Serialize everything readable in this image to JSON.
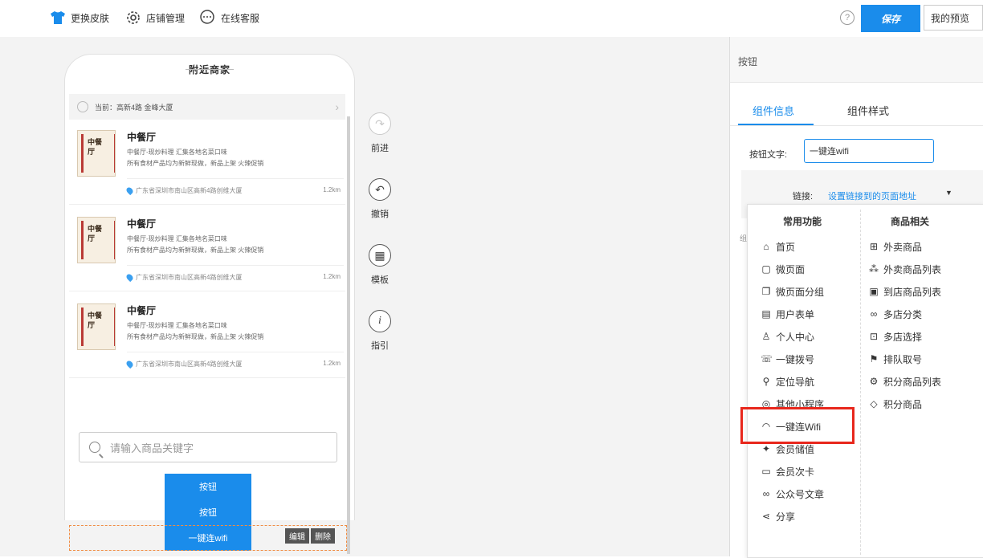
{
  "topbar": {
    "skin_label": "更换皮肤",
    "store_label": "店铺管理",
    "service_label": "在线客服",
    "help_icon": "?",
    "save_label": "保存",
    "preview_label": "我的预览"
  },
  "phone": {
    "title": "附近商家",
    "location_label": "当前：高新4路 金峰大厦",
    "stores": [
      {
        "name": "中餐厅",
        "desc1": "中餐厅-现炒料理   汇集各地名菜口味",
        "desc2": "所有食材产品均为新鲜现做，新品上架 火辣促销",
        "address": "广东省深圳市南山区高新4路创维大厦",
        "distance": "1.2km"
      },
      {
        "name": "中餐厅",
        "desc1": "中餐厅-现炒料理   汇集各地名菜口味",
        "desc2": "所有食材产品均为新鲜现做，新品上架 火辣促销",
        "address": "广东省深圳市南山区高新4路创维大厦",
        "distance": "1.2km"
      },
      {
        "name": "中餐厅",
        "desc1": "中餐厅-现炒料理   汇集各地名菜口味",
        "desc2": "所有食材产品均为新鲜现做，新品上架 火辣促销",
        "address": "广东省深圳市南山区高新4路创维大厦",
        "distance": "1.2km"
      }
    ],
    "logo_glyph": "中餐厅",
    "search_placeholder": "请输入商品关键字",
    "buttons": [
      "按钮",
      "按钮",
      "一键连wifi"
    ],
    "edit_label": "编辑",
    "delete_label": "删除"
  },
  "toolbar": {
    "forward": "前进",
    "undo": "撤销",
    "template": "模板",
    "guide": "指引"
  },
  "panel": {
    "header": "按钮",
    "tab_info": "组件信息",
    "tab_style": "组件样式",
    "button_text_label": "按钮文字:",
    "button_text_value": "一键连wifi",
    "link_label": "链接:",
    "link_value": "设置链接到的页面地址",
    "side_text": "组"
  },
  "dropdown": {
    "col1_header": "常用功能",
    "col2_header": "商品相关",
    "col1": [
      {
        "label": "首页",
        "icon": "home-icon",
        "glyph": "⌂"
      },
      {
        "label": "微页面",
        "icon": "page-icon",
        "glyph": "▢"
      },
      {
        "label": "微页面分组",
        "icon": "pages-icon",
        "glyph": "❐"
      },
      {
        "label": "用户表单",
        "icon": "form-icon",
        "glyph": "▤"
      },
      {
        "label": "个人中心",
        "icon": "user-icon",
        "glyph": "♙"
      },
      {
        "label": "一键拨号",
        "icon": "phone-icon",
        "glyph": "☏"
      },
      {
        "label": "定位导航",
        "icon": "location-icon",
        "glyph": "⚲"
      },
      {
        "label": "其他小程序",
        "icon": "miniapp-icon",
        "glyph": "◎"
      },
      {
        "label": "一键连Wifi",
        "icon": "wifi-icon",
        "glyph": "◠"
      },
      {
        "label": "会员储值",
        "icon": "vip-icon",
        "glyph": "✦"
      },
      {
        "label": "会员次卡",
        "icon": "card-icon",
        "glyph": "▭"
      },
      {
        "label": "公众号文章",
        "icon": "article-icon",
        "glyph": "∞"
      },
      {
        "label": "分享",
        "icon": "share-icon",
        "glyph": "⋖"
      }
    ],
    "col2": [
      {
        "label": "外卖商品",
        "icon": "gift-icon",
        "glyph": "⊞"
      },
      {
        "label": "外卖商品列表",
        "icon": "list-icon",
        "glyph": "⁂"
      },
      {
        "label": "到店商品列表",
        "icon": "store-list-icon",
        "glyph": "▣"
      },
      {
        "label": "多店分类",
        "icon": "category-icon",
        "glyph": "∞"
      },
      {
        "label": "多店选择",
        "icon": "select-icon",
        "glyph": "⊡"
      },
      {
        "label": "排队取号",
        "icon": "queue-icon",
        "glyph": "⚑"
      },
      {
        "label": "积分商品列表",
        "icon": "points-list-icon",
        "glyph": "⚙"
      },
      {
        "label": "积分商品",
        "icon": "diamond-icon",
        "glyph": "◇"
      }
    ]
  },
  "colors": {
    "accent": "#1a8ceb",
    "highlight": "#e8271c",
    "selection": "#f08c42"
  }
}
